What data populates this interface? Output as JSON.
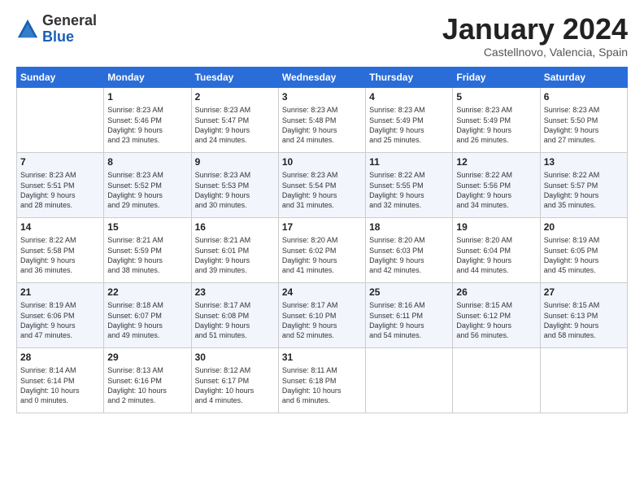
{
  "logo": {
    "general": "General",
    "blue": "Blue"
  },
  "header": {
    "title": "January 2024",
    "subtitle": "Castellnovo, Valencia, Spain"
  },
  "weekdays": [
    "Sunday",
    "Monday",
    "Tuesday",
    "Wednesday",
    "Thursday",
    "Friday",
    "Saturday"
  ],
  "weeks": [
    [
      {
        "day": "",
        "info": ""
      },
      {
        "day": "1",
        "info": "Sunrise: 8:23 AM\nSunset: 5:46 PM\nDaylight: 9 hours\nand 23 minutes."
      },
      {
        "day": "2",
        "info": "Sunrise: 8:23 AM\nSunset: 5:47 PM\nDaylight: 9 hours\nand 24 minutes."
      },
      {
        "day": "3",
        "info": "Sunrise: 8:23 AM\nSunset: 5:48 PM\nDaylight: 9 hours\nand 24 minutes."
      },
      {
        "day": "4",
        "info": "Sunrise: 8:23 AM\nSunset: 5:49 PM\nDaylight: 9 hours\nand 25 minutes."
      },
      {
        "day": "5",
        "info": "Sunrise: 8:23 AM\nSunset: 5:49 PM\nDaylight: 9 hours\nand 26 minutes."
      },
      {
        "day": "6",
        "info": "Sunrise: 8:23 AM\nSunset: 5:50 PM\nDaylight: 9 hours\nand 27 minutes."
      }
    ],
    [
      {
        "day": "7",
        "info": "Sunrise: 8:23 AM\nSunset: 5:51 PM\nDaylight: 9 hours\nand 28 minutes."
      },
      {
        "day": "8",
        "info": "Sunrise: 8:23 AM\nSunset: 5:52 PM\nDaylight: 9 hours\nand 29 minutes."
      },
      {
        "day": "9",
        "info": "Sunrise: 8:23 AM\nSunset: 5:53 PM\nDaylight: 9 hours\nand 30 minutes."
      },
      {
        "day": "10",
        "info": "Sunrise: 8:23 AM\nSunset: 5:54 PM\nDaylight: 9 hours\nand 31 minutes."
      },
      {
        "day": "11",
        "info": "Sunrise: 8:22 AM\nSunset: 5:55 PM\nDaylight: 9 hours\nand 32 minutes."
      },
      {
        "day": "12",
        "info": "Sunrise: 8:22 AM\nSunset: 5:56 PM\nDaylight: 9 hours\nand 34 minutes."
      },
      {
        "day": "13",
        "info": "Sunrise: 8:22 AM\nSunset: 5:57 PM\nDaylight: 9 hours\nand 35 minutes."
      }
    ],
    [
      {
        "day": "14",
        "info": "Sunrise: 8:22 AM\nSunset: 5:58 PM\nDaylight: 9 hours\nand 36 minutes."
      },
      {
        "day": "15",
        "info": "Sunrise: 8:21 AM\nSunset: 5:59 PM\nDaylight: 9 hours\nand 38 minutes."
      },
      {
        "day": "16",
        "info": "Sunrise: 8:21 AM\nSunset: 6:01 PM\nDaylight: 9 hours\nand 39 minutes."
      },
      {
        "day": "17",
        "info": "Sunrise: 8:20 AM\nSunset: 6:02 PM\nDaylight: 9 hours\nand 41 minutes."
      },
      {
        "day": "18",
        "info": "Sunrise: 8:20 AM\nSunset: 6:03 PM\nDaylight: 9 hours\nand 42 minutes."
      },
      {
        "day": "19",
        "info": "Sunrise: 8:20 AM\nSunset: 6:04 PM\nDaylight: 9 hours\nand 44 minutes."
      },
      {
        "day": "20",
        "info": "Sunrise: 8:19 AM\nSunset: 6:05 PM\nDaylight: 9 hours\nand 45 minutes."
      }
    ],
    [
      {
        "day": "21",
        "info": "Sunrise: 8:19 AM\nSunset: 6:06 PM\nDaylight: 9 hours\nand 47 minutes."
      },
      {
        "day": "22",
        "info": "Sunrise: 8:18 AM\nSunset: 6:07 PM\nDaylight: 9 hours\nand 49 minutes."
      },
      {
        "day": "23",
        "info": "Sunrise: 8:17 AM\nSunset: 6:08 PM\nDaylight: 9 hours\nand 51 minutes."
      },
      {
        "day": "24",
        "info": "Sunrise: 8:17 AM\nSunset: 6:10 PM\nDaylight: 9 hours\nand 52 minutes."
      },
      {
        "day": "25",
        "info": "Sunrise: 8:16 AM\nSunset: 6:11 PM\nDaylight: 9 hours\nand 54 minutes."
      },
      {
        "day": "26",
        "info": "Sunrise: 8:15 AM\nSunset: 6:12 PM\nDaylight: 9 hours\nand 56 minutes."
      },
      {
        "day": "27",
        "info": "Sunrise: 8:15 AM\nSunset: 6:13 PM\nDaylight: 9 hours\nand 58 minutes."
      }
    ],
    [
      {
        "day": "28",
        "info": "Sunrise: 8:14 AM\nSunset: 6:14 PM\nDaylight: 10 hours\nand 0 minutes."
      },
      {
        "day": "29",
        "info": "Sunrise: 8:13 AM\nSunset: 6:16 PM\nDaylight: 10 hours\nand 2 minutes."
      },
      {
        "day": "30",
        "info": "Sunrise: 8:12 AM\nSunset: 6:17 PM\nDaylight: 10 hours\nand 4 minutes."
      },
      {
        "day": "31",
        "info": "Sunrise: 8:11 AM\nSunset: 6:18 PM\nDaylight: 10 hours\nand 6 minutes."
      },
      {
        "day": "",
        "info": ""
      },
      {
        "day": "",
        "info": ""
      },
      {
        "day": "",
        "info": ""
      }
    ]
  ]
}
